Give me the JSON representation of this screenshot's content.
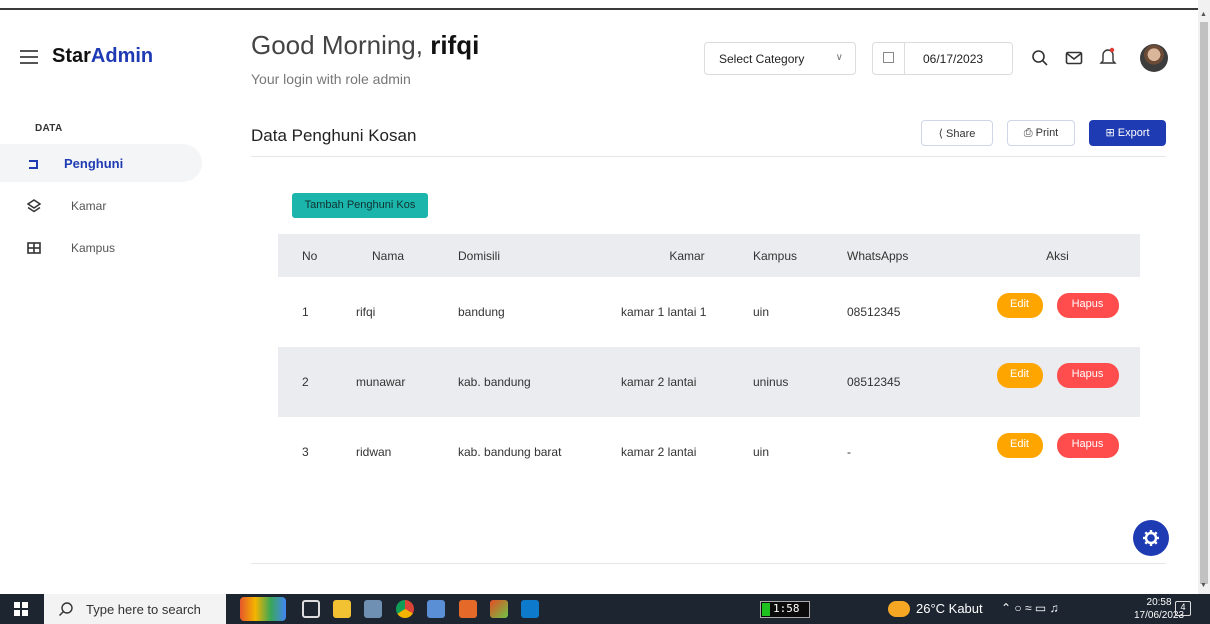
{
  "brand": {
    "part1": "Star",
    "part2": "Admin"
  },
  "header": {
    "greeting": "Good Morning,",
    "username": "rifqi",
    "subtitle": "Your login with role admin",
    "select_category": "Select Category",
    "date": "06/17/2023"
  },
  "sidebar": {
    "section": "DATA",
    "items": [
      {
        "label": "Penghuni",
        "icon": "user-icon",
        "active": true
      },
      {
        "label": "Kamar",
        "icon": "layers-icon",
        "active": false
      },
      {
        "label": "Kampus",
        "icon": "grid-icon",
        "active": false
      }
    ]
  },
  "content": {
    "title": "Data Penghuni Kosan",
    "share": "Share",
    "print": "Print",
    "export": "Export",
    "add_button": "Tambah Penghuni Kos"
  },
  "table": {
    "headers": [
      "No",
      "Nama",
      "Domisili",
      "Kamar",
      "Kampus",
      "WhatsApps",
      "Aksi"
    ],
    "rows": [
      {
        "no": "1",
        "nama": "rifqi",
        "domisili": "bandung",
        "kamar": "kamar 1 lantai 1",
        "kampus": "uin",
        "wa": "08512345"
      },
      {
        "no": "2",
        "nama": "munawar",
        "domisili": "kab. bandung",
        "kamar": "kamar 2 lantai",
        "kampus": "uninus",
        "wa": "08512345"
      },
      {
        "no": "3",
        "nama": "ridwan",
        "domisili": "kab. bandung barat",
        "kamar": "kamar 2 lantai",
        "kampus": "uin",
        "wa": "-"
      }
    ],
    "edit_label": "Edit",
    "delete_label": "Hapus"
  },
  "taskbar": {
    "search_placeholder": "Type here to search",
    "battery_time": "1:58",
    "weather": "26°C Kabut",
    "time": "20:58",
    "date": "17/06/2023",
    "notifications": "4"
  },
  "colors": {
    "accent": "#1f3bb3",
    "teal": "#1bb5ac",
    "edit": "#ffa500",
    "delete": "#ff4c4c"
  }
}
